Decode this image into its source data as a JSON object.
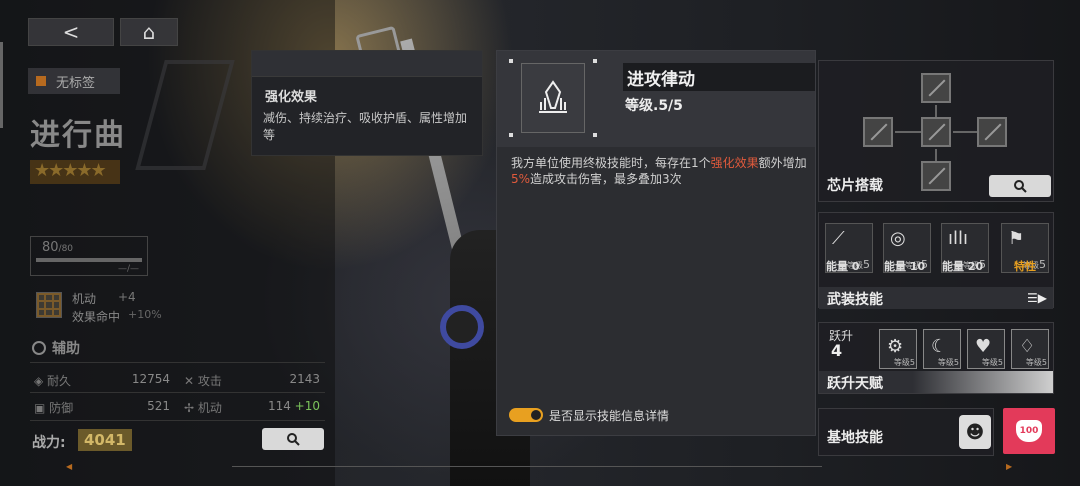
{
  "nav": {
    "back_label": "<",
    "home_label": "⌂"
  },
  "character": {
    "tag": "无标签",
    "name": "进行曲",
    "stars": "★★★★★",
    "hp_value": "80",
    "hp_max": "/80",
    "hp_sub": "—/—",
    "mobility_label": "机动",
    "mobility_bonus": "+4",
    "hit_label": "效果命中",
    "hit_value": "+10%",
    "class_label": "辅助",
    "stats": {
      "durability_label": "耐久",
      "durability_value": "12754",
      "attack_label": "攻击",
      "attack_value": "2143",
      "defense_label": "防御",
      "defense_value": "521",
      "mobility_label": "机动",
      "mobility_value": "114",
      "mobility_bonus": "+10"
    },
    "power_label": "战力:",
    "power_value": "4041"
  },
  "tooltip": {
    "title": "强化效果",
    "body": "减伤、持续治疗、吸收护盾、属性增加等"
  },
  "skill": {
    "name": "进攻律动",
    "level": "等级.5/5",
    "desc_part1": "我方单位使用终极技能时，每存在1个",
    "desc_highlight1": "强化效果",
    "desc_part2": "额外增加",
    "desc_highlight2": "5%",
    "desc_part3": "造成攻击伤害，最多叠加3次",
    "toggle_label": "是否显示技能信息详情",
    "toggle_on": true
  },
  "chip": {
    "label": "芯片搭载"
  },
  "armed_skills": {
    "label": "武装技能",
    "items": [
      {
        "icon": "wing-icon",
        "glyph": "⟋",
        "level_prefix": "等级",
        "level": "5",
        "energy": "能量 0"
      },
      {
        "icon": "orbit-icon",
        "glyph": "◎",
        "level_prefix": "等级",
        "level": "5",
        "energy": "能量 10"
      },
      {
        "icon": "wave-icon",
        "glyph": "ıllı",
        "level_prefix": "等级",
        "level": "5",
        "energy": "能量 20"
      },
      {
        "icon": "flag-icon",
        "glyph": "⚑",
        "level_prefix": "等级",
        "level": "5",
        "energy": "特性"
      }
    ]
  },
  "leap": {
    "label": "跃升",
    "level": "4",
    "talent_label": "跃升天赋",
    "items": [
      {
        "icon": "gear-house-icon",
        "glyph": "⚙",
        "level": "等级5"
      },
      {
        "icon": "moon-sparkle-icon",
        "glyph": "☾",
        "level": "等级5"
      },
      {
        "icon": "heart-wing-icon",
        "glyph": "♥",
        "level": "等级5"
      },
      {
        "icon": "crystal-wave-icon",
        "glyph": "♢",
        "level": "等级5"
      }
    ]
  },
  "base_skill": {
    "label": "基地技能",
    "icon": "laugh-face-icon",
    "glyph": "☻"
  },
  "like": {
    "value": "100"
  },
  "colors": {
    "accent_orange": "#e8a020",
    "highlight_red": "#e05a3c",
    "like_pink": "#e33a5a",
    "power_gold": "#d3b868"
  }
}
